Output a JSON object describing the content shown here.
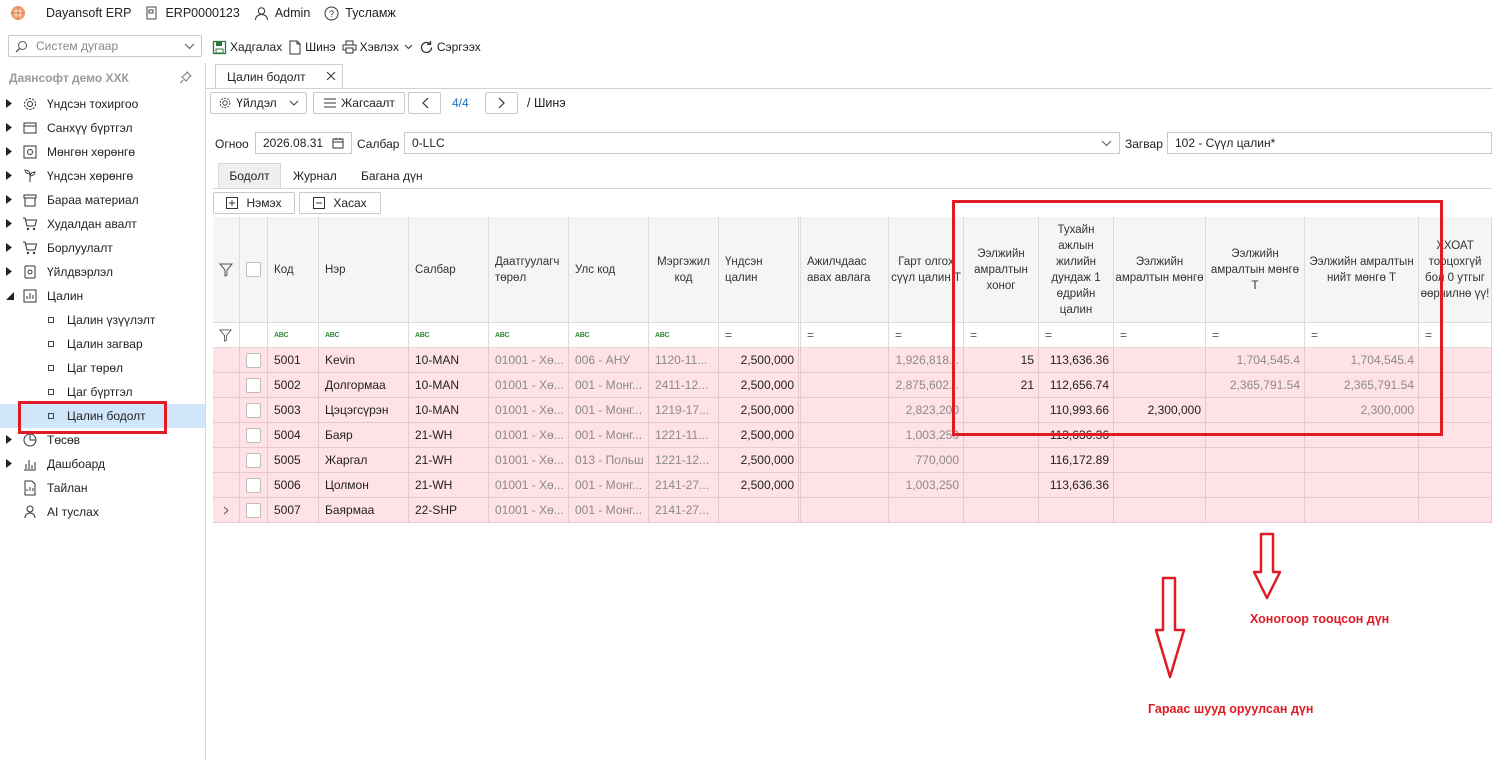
{
  "titlebar": {
    "app_name": "Dayansoft ERP",
    "doc_code": "ERP0000123",
    "user": "Admin",
    "help": "Тусламж"
  },
  "search": {
    "placeholder": "Систем дугаар"
  },
  "toolbar": {
    "save": "Хадгалах",
    "new": "Шинэ",
    "print": "Хэвлэх",
    "refresh": "Сэргээх"
  },
  "sidebar": {
    "company": "Даянсофт демо ХХК",
    "items": [
      {
        "label": "Үндсэн тохиргоо",
        "icon": "gear-icon"
      },
      {
        "label": "Санхүү бүртгэл",
        "icon": "ledger-icon"
      },
      {
        "label": "Мөнгөн хөрөнгө",
        "icon": "cash-icon"
      },
      {
        "label": "Үндсэн хөрөнгө",
        "icon": "asset-icon"
      },
      {
        "label": "Бараа материал",
        "icon": "inventory-icon"
      },
      {
        "label": "Худалдан авалт",
        "icon": "cart-icon"
      },
      {
        "label": "Борлуулалт",
        "icon": "sales-cart-icon"
      },
      {
        "label": "Үйлдвэрлэл",
        "icon": "factory-icon"
      },
      {
        "label": "Цалин",
        "icon": "salary-icon"
      },
      {
        "label": "Цалин үзүүлэлт"
      },
      {
        "label": "Цалин загвар"
      },
      {
        "label": "Цаг төрөл"
      },
      {
        "label": "Цаг бүртгэл"
      },
      {
        "label": "Цалин бодолт"
      },
      {
        "label": "Төсөв",
        "icon": "pie-chart-icon"
      },
      {
        "label": "Дашбоард",
        "icon": "dashboard-icon"
      },
      {
        "label": "Тайлан",
        "icon": "report-icon"
      },
      {
        "label": "AI туслах",
        "icon": "ai-assistant-icon"
      }
    ]
  },
  "doc_tab": {
    "label": "Цалин бодолт"
  },
  "nav_bar": {
    "actions": "Үйлдэл",
    "sort": "Жагсаалт",
    "page": "4/4",
    "mode": "/ Шинэ"
  },
  "form": {
    "date_label": "Огноо",
    "date_value": "2026.08.31",
    "branch_label": "Салбар",
    "branch_value": "0-LLC",
    "template_label": "Загвар",
    "template_value": "102 - Сүүл цалин*"
  },
  "subtabs": [
    "Бодолт",
    "Журнал",
    "Багана дүн"
  ],
  "grid_buttons": {
    "add": "Нэмэх",
    "remove": "Хасах"
  },
  "grid": {
    "headers": [
      "Код",
      "Нэр",
      "Салбар",
      "Даатгуулагч төрөл",
      "Улс код",
      "Мэргэжил код",
      "Үндсэн цалин",
      "Ажилчдаас авах авлага",
      "Гарт олгох сүүл цалин Т",
      "Ээлжийн амралтын хоног",
      "Тухайн ажлын жилийн дундаж 1 өдрийн цалин",
      "Ээлжийн амралтын мөнгө",
      "Ээлжийн амралтын мөнгө Т",
      "Ээлжийн амралтын нийт мөнгө Т",
      "ХХОАТ тооцохгүй бол 0 утгыг өөрчилнө үү!"
    ],
    "rows": [
      [
        "5001",
        "Kevin",
        "10-MAN",
        "01001 - Хө...",
        "006 - АНУ",
        "1120-11...",
        "2,500,000",
        "",
        "1,926,818...",
        "15",
        "113,636.36",
        "",
        "1,704,545.4",
        "1,704,545.4",
        ""
      ],
      [
        "5002",
        "Долгормаа",
        "10-MAN",
        "01001 - Хө...",
        "001 - Монг...",
        "2411-12...",
        "2,500,000",
        "",
        "2,875,602...",
        "21",
        "112,656.74",
        "",
        "2,365,791.54",
        "2,365,791.54",
        ""
      ],
      [
        "5003",
        "Цэцэгсүрэн",
        "10-MAN",
        "01001 - Хө...",
        "001 - Монг...",
        "1219-17...",
        "2,500,000",
        "",
        "2,823,200",
        "",
        "110,993.66",
        "2,300,000",
        "",
        "2,300,000",
        ""
      ],
      [
        "5004",
        "Баяр",
        "21-WH",
        "01001 - Хө...",
        "001 - Монг...",
        "1221-11...",
        "2,500,000",
        "",
        "1,003,250",
        "",
        "113,636.36",
        "",
        "",
        "",
        ""
      ],
      [
        "5005",
        "Жаргал",
        "21-WH",
        "01001 - Хө...",
        "013 - Польш",
        "1221-12...",
        "2,500,000",
        "",
        "770,000",
        "",
        "116,172.89",
        "",
        "",
        "",
        ""
      ],
      [
        "5006",
        "Цолмон",
        "21-WH",
        "01001 - Хө...",
        "001 - Монг...",
        "2141-27...",
        "2,500,000",
        "",
        "1,003,250",
        "",
        "113,636.36",
        "",
        "",
        "",
        ""
      ],
      [
        "5007",
        "Баярмаа",
        "22-SHP",
        "01001 - Хө...",
        "001 - Монг...",
        "2141-27...",
        "",
        "",
        "",
        "",
        "",
        "",
        "",
        "",
        ""
      ]
    ]
  },
  "annotations": {
    "computed": "Хоногоор тооцсон дүн",
    "manual": "Гараас шууд оруулсан дүн"
  }
}
